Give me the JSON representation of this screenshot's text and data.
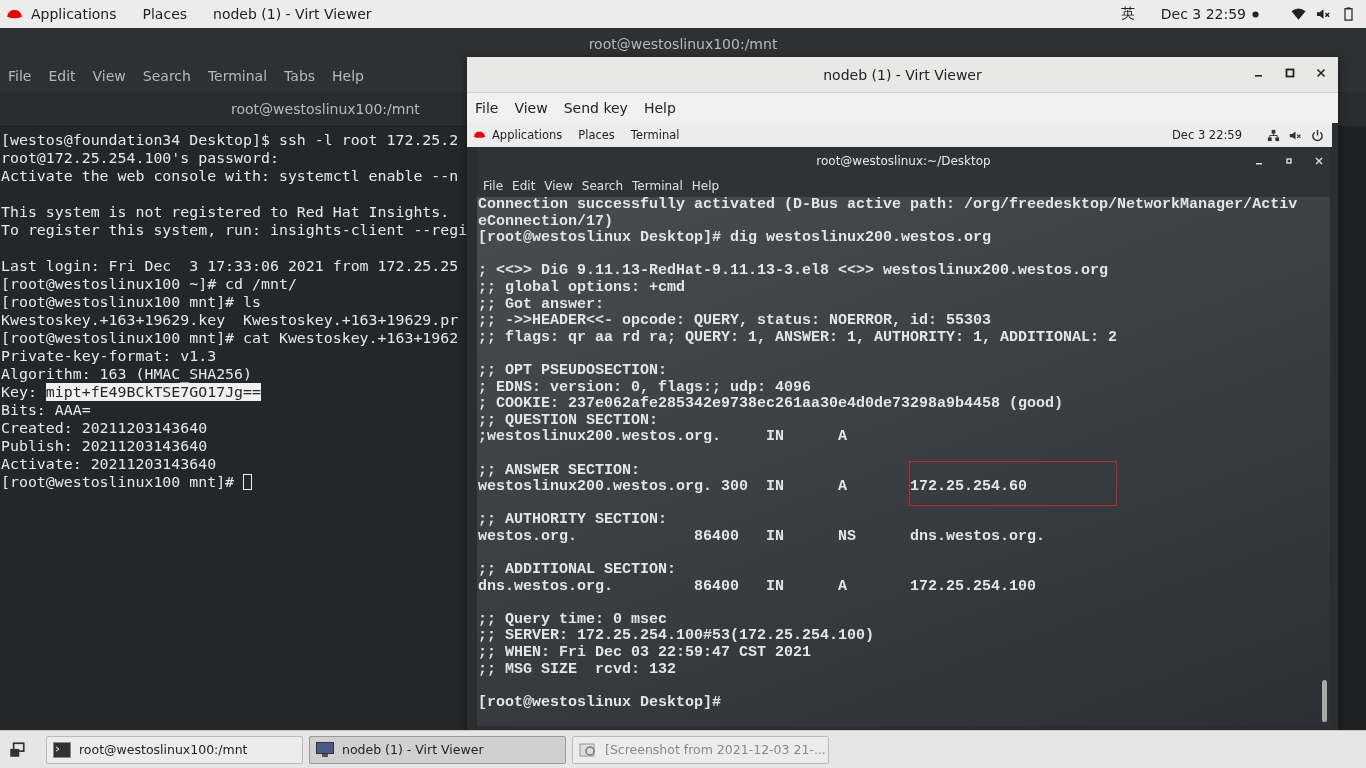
{
  "top_bar": {
    "applications": "Applications",
    "places": "Places",
    "active_window": "nodeb (1) - Virt Viewer",
    "input_method": "英",
    "clock": "Dec 3  22:59"
  },
  "terminal": {
    "title": "root@westoslinux100:/mnt",
    "menu": [
      "File",
      "Edit",
      "View",
      "Search",
      "Terminal",
      "Tabs",
      "Help"
    ],
    "tab_title": "root@westoslinux100:/mnt",
    "lines": [
      {
        "text": "[westos@foundation34 Desktop]$ ssh -l root 172.25.2"
      },
      {
        "text": "root@172.25.254.100's password:"
      },
      {
        "text": "Activate the web console with: systemctl enable --n"
      },
      {
        "text": "This system is not registered to Red Hat Insights.",
        "blank_before": true
      },
      {
        "text": "To register this system, run: insights-client --regi"
      },
      {
        "text": "Last login: Fri Dec  3 17:33:06 2021 from 172.25.25",
        "blank_before": true
      },
      {
        "text": "[root@westoslinux100 ~]# cd /mnt/"
      },
      {
        "text": "[root@westoslinux100 mnt]# ls"
      },
      {
        "text": "Kwestoskey.+163+19629.key  Kwestoskey.+163+19629.pr"
      },
      {
        "text": "[root@westoslinux100 mnt]# cat Kwestoskey.+163+1962"
      },
      {
        "text": "Private-key-format: v1.3"
      },
      {
        "text": "Algorithm: 163 (HMAC_SHA256)"
      },
      {
        "text": "Key: ",
        "selection": "mipt+fE49BCkTSE7GO17Jg=="
      },
      {
        "text": "Bits: AAA="
      },
      {
        "text": "Created: 20211203143640"
      },
      {
        "text": "Publish: 20211203143640"
      },
      {
        "text": "Activate: 20211203143640"
      },
      {
        "text": "[root@westoslinux100 mnt]# ",
        "cursor": true
      }
    ]
  },
  "viewer": {
    "title": "nodeb (1) - Virt Viewer",
    "menu": [
      "File",
      "View",
      "Send key",
      "Help"
    ],
    "guest_bar": {
      "applications": "Applications",
      "places": "Places",
      "app": "Terminal",
      "clock": "Dec 3  22:59"
    },
    "guest_terminal": {
      "title": "root@westoslinux:~/Desktop",
      "menu": [
        "File",
        "Edit",
        "View",
        "Search",
        "Terminal",
        "Help"
      ],
      "lines": [
        {
          "text": "Connection successfully activated (D-Bus active path: /org/freedesktop/NetworkManager/Activ"
        },
        {
          "text": "eConnection/17)"
        },
        {
          "text": "[root@westoslinux Desktop]# dig westoslinux200.westos.org"
        },
        {
          "text": "; <<>> DiG 9.11.13-RedHat-9.11.13-3.el8 <<>> westoslinux200.westos.org",
          "blank_before": true
        },
        {
          "text": ";; global options: +cmd"
        },
        {
          "text": ";; Got answer:"
        },
        {
          "text": ";; ->>HEADER<<- opcode: QUERY, status: NOERROR, id: 55303"
        },
        {
          "text": ";; flags: qr aa rd ra; QUERY: 1, ANSWER: 1, AUTHORITY: 1, ADDITIONAL: 2"
        },
        {
          "text": ";; OPT PSEUDOSECTION:",
          "blank_before": true
        },
        {
          "text": "; EDNS: version: 0, flags:; udp: 4096"
        },
        {
          "text": "; COOKIE: 237e062afe285342e9738ec261aa30e4d0de73298a9b4458 (good)"
        },
        {
          "text": ";; QUESTION SECTION:"
        },
        {
          "text": ";westoslinux200.westos.org.     IN      A"
        },
        {
          "text": ";; ANSWER SECTION:",
          "blank_before": true
        },
        {
          "text": "westoslinux200.westos.org. 300  IN      A       172.25.254.60",
          "highlighted": true
        },
        {
          "text": ";; AUTHORITY SECTION:",
          "blank_before": true
        },
        {
          "text": "westos.org.             86400   IN      NS      dns.westos.org."
        },
        {
          "text": ";; ADDITIONAL SECTION:",
          "blank_before": true
        },
        {
          "text": "dns.westos.org.         86400   IN      A       172.25.254.100"
        },
        {
          "text": ";; Query time: 0 msec",
          "blank_before": true
        },
        {
          "text": ";; SERVER: 172.25.254.100#53(172.25.254.100)"
        },
        {
          "text": ";; WHEN: Fri Dec 03 22:59:47 CST 2021"
        },
        {
          "text": ";; MSG SIZE  rcvd: 132"
        },
        {
          "text": "[root@westoslinux Desktop]#",
          "blank_before": true
        }
      ]
    }
  },
  "taskbar": {
    "items": [
      {
        "label": "root@westoslinux100:/mnt",
        "kind": "terminal",
        "selected": false
      },
      {
        "label": "nodeb (1) - Virt Viewer",
        "kind": "viewer",
        "selected": true
      },
      {
        "label": "[Screenshot from 2021-12-03 21-...",
        "kind": "screenshot",
        "selected": false
      }
    ]
  }
}
